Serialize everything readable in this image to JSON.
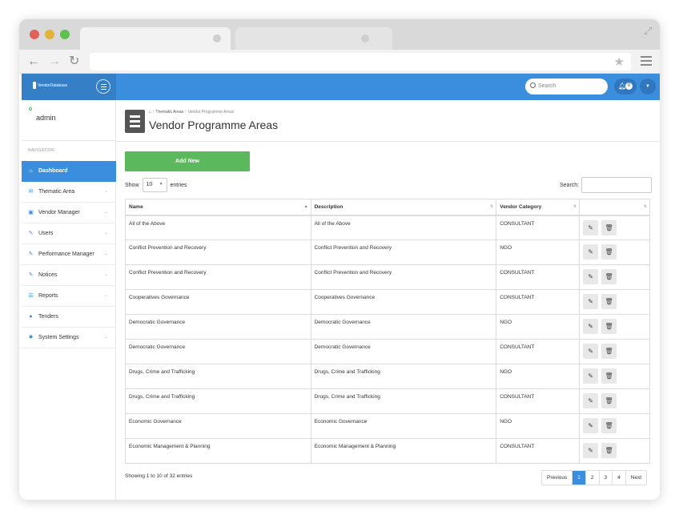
{
  "brand": {
    "logo_text": "VendorDatabase"
  },
  "topbar": {
    "search_placeholder": "Search",
    "notification_count": "0"
  },
  "sidebar": {
    "user_name": "admin",
    "nav_heading": "NAVIGATION",
    "items": [
      {
        "label": "Dashboard",
        "icon": "home-icon",
        "active": true
      },
      {
        "label": "Thematic Area",
        "icon": "envelope-icon"
      },
      {
        "label": "Vendor Manager",
        "icon": "briefcase-icon"
      },
      {
        "label": "Users",
        "icon": "edit-icon"
      },
      {
        "label": "Performance Manager",
        "icon": "edit-icon"
      },
      {
        "label": "Notices",
        "icon": "edit-icon"
      },
      {
        "label": "Reports",
        "icon": "list-icon"
      },
      {
        "label": "Tenders",
        "icon": "map-marker-icon"
      },
      {
        "label": "System Settings",
        "icon": "gear-icon"
      }
    ]
  },
  "breadcrumb": {
    "parent": "Thematic Areas",
    "current": "Vendor Programme Areas"
  },
  "page": {
    "title": "Vendor Programme Areas"
  },
  "toolbar": {
    "add_label": "Add New",
    "show_label": "Show",
    "length_value": "10",
    "entries_label": "entries",
    "search_label": "Search:"
  },
  "table": {
    "headers": [
      "Name",
      "Description",
      "Vendor Category",
      ""
    ],
    "rows": [
      {
        "name": "All of the Above",
        "description": "All of the Above",
        "category": "CONSULTANT"
      },
      {
        "name": "Conflict Prevention and Recovery",
        "description": "Conflict Prevention and Recovery",
        "category": "NGO"
      },
      {
        "name": "Conflict Prevention and Recovery",
        "description": "Conflict Prevention and Recovery",
        "category": "CONSULTANT"
      },
      {
        "name": "Cooperatives Governance",
        "description": "Cooperatives Governance",
        "category": "CONSULTANT"
      },
      {
        "name": "Democratic Governance",
        "description": "Democratic Governance",
        "category": "NGO"
      },
      {
        "name": "Democratic Governance",
        "description": "Democratic Governance",
        "category": "CONSULTANT"
      },
      {
        "name": "Drugs, Crime and Trafficking",
        "description": "Drugs, Crime and Trafficking",
        "category": "NGO"
      },
      {
        "name": "Drugs, Crime and Trafficking",
        "description": "Drugs, Crime and Trafficking",
        "category": "CONSULTANT"
      },
      {
        "name": "Economic Governance",
        "description": "Economic Governance",
        "category": "NGO"
      },
      {
        "name": "Economic Management & Planning",
        "description": "Economic Management & Planning",
        "category": "CONSULTANT"
      }
    ]
  },
  "footer": {
    "info": "Showing 1 to 10 of 32 entries",
    "pagination": [
      "Previous",
      "1",
      "2",
      "3",
      "4",
      "Next"
    ],
    "current_page": "1"
  }
}
